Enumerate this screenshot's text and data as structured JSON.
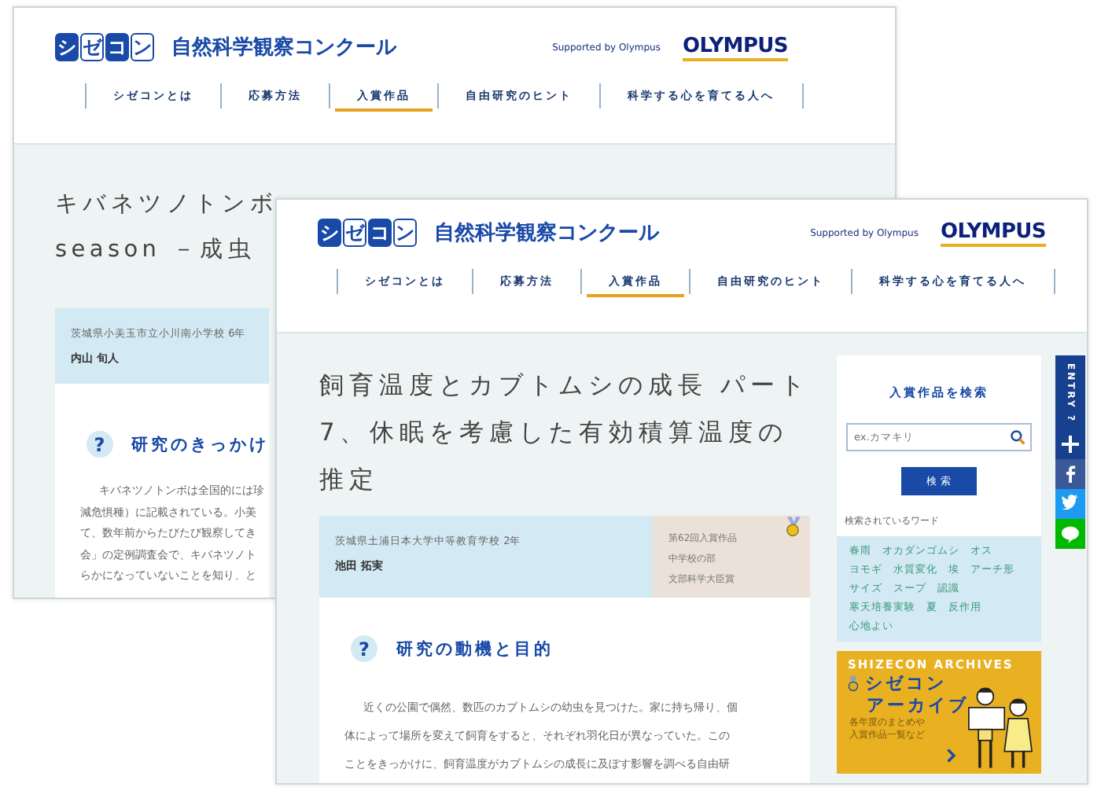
{
  "back_page": {
    "header": {
      "logo": [
        "シ",
        "ゼ",
        "コ",
        "ン"
      ],
      "site_name": "自然科学観察コンクール",
      "supported": "Supported by Olympus",
      "brand": "OLYMPUS",
      "nav": [
        {
          "label": "シゼコンとは",
          "selected": false
        },
        {
          "label": "応募方法",
          "selected": false
        },
        {
          "label": "入賞作品",
          "selected": true
        },
        {
          "label": "自由研究のヒント",
          "selected": false
        },
        {
          "label": "科学する心を育てる人へ",
          "selected": false
        }
      ]
    },
    "title_lines": [
      "キバネツノトンボ",
      "season －成虫"
    ],
    "school": "茨城県小美玉市立小川南小学校 6年",
    "author": "内山 旬人",
    "heading_icon": "?",
    "heading": "研究のきっかけ",
    "paragraph_lines": [
      "キバネツノトンボは全国的には珍",
      "減危惧種）に記載されている。小美",
      "て、数年前からたびたび観察してき",
      "会」の定例調査会で、キバネツノト",
      "らかになっていないことを知り、と"
    ]
  },
  "front_page": {
    "header": {
      "logo": [
        "シ",
        "ゼ",
        "コ",
        "ン"
      ],
      "site_name": "自然科学観察コンクール",
      "supported": "Supported by Olympus",
      "brand": "OLYMPUS",
      "nav": [
        {
          "label": "シゼコンとは",
          "selected": false
        },
        {
          "label": "応募方法",
          "selected": false
        },
        {
          "label": "入賞作品",
          "selected": true
        },
        {
          "label": "自由研究のヒント",
          "selected": false
        },
        {
          "label": "科学する心を育てる人へ",
          "selected": false
        }
      ]
    },
    "title_lines": [
      "飼育温度とカブトムシの成長 パート",
      "7、休眠を考慮した有効積算温度の",
      "推定"
    ],
    "school": "茨城県土浦日本大学中等教育学校 2年",
    "author": "池田 拓実",
    "award": [
      "第62回入賞作品",
      "中学校の部",
      "文部科学大臣賞"
    ],
    "heading_icon": "?",
    "heading": "研究の動機と目的",
    "paragraph_lines": [
      "近くの公園で偶然、数匹のカブトムシの幼虫を見つけた。家に持ち帰り、個",
      "体によって場所を変えて飼育をすると、それぞれ羽化日が異なっていた。この",
      "ことをきっかけに、飼育温度がカブトムシの成長に及ぼす影響を調べる自由研"
    ],
    "sidebar": {
      "search_title": "入賞作品を検索",
      "search": {
        "placeholder": "ex.カマキリ"
      },
      "search_button": "検 索",
      "popular_label": "検索されているワード",
      "tags": [
        "春雨",
        "オカダンゴムシ",
        "オス",
        "ヨモギ",
        "水質変化",
        "埃",
        "アーチ形",
        "サイズ",
        "スープ",
        "認識",
        "寒天培養実験",
        "夏",
        "反作用",
        "心地よい"
      ],
      "archive": {
        "title": "SHIZECON ARCHIVES",
        "line1": "シゼコン",
        "line2": "アーカイブ",
        "note": [
          "各年度のまとめや",
          "入賞作品一覧など"
        ]
      }
    },
    "share": {
      "entry": "ENTRY ?",
      "buttons": [
        {
          "kind": "plus"
        },
        {
          "kind": "facebook"
        },
        {
          "kind": "twitter"
        },
        {
          "kind": "line"
        }
      ]
    }
  }
}
